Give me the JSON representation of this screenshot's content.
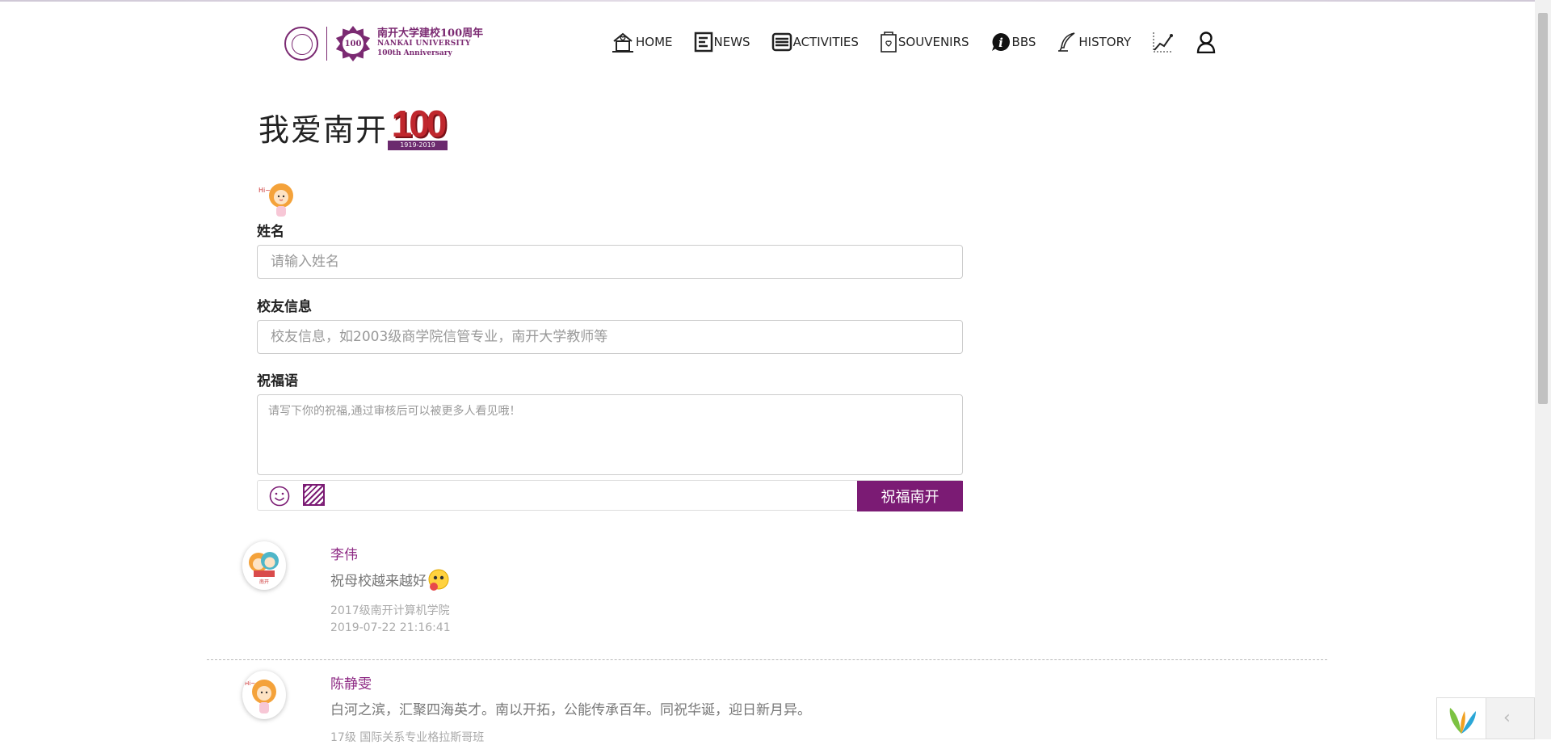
{
  "header": {
    "logo": {
      "line1": "南开大学建校100周年",
      "line2": "NANKAI UNIVERSITY",
      "line3": "100th Anniversary",
      "badge": "100"
    },
    "nav": [
      {
        "label": "HOME",
        "icon": "home-icon"
      },
      {
        "label": "NEWS",
        "icon": "news-icon"
      },
      {
        "label": "ACTIVITIES",
        "icon": "activities-icon"
      },
      {
        "label": "SOUVENIRS",
        "icon": "souvenirs-icon"
      },
      {
        "label": "BBS",
        "icon": "info-icon"
      },
      {
        "label": "HISTORY",
        "icon": "quill-icon"
      },
      {
        "label": "",
        "icon": "chart-icon"
      },
      {
        "label": "",
        "icon": "user-icon"
      }
    ]
  },
  "hero": {
    "title": "我爱南开",
    "badge_number": "100",
    "badge_years": "1919-2019"
  },
  "form": {
    "name_label": "姓名",
    "name_placeholder": "请输入姓名",
    "alumni_label": "校友信息",
    "alumni_placeholder": "校友信息，如2003级商学院信管专业，南开大学教师等",
    "wish_label": "祝福语",
    "wish_placeholder": "请写下你的祝福,通过审核后可以被更多人看见哦！",
    "submit_label": "祝福南开"
  },
  "comments": [
    {
      "name": "李伟",
      "text": "祝母校越来越好",
      "info": "2017级南开计算机学院",
      "time": "2019-07-22 21:16:41"
    },
    {
      "name": "陈静雯",
      "text": "白河之滨，汇聚四海英才。南以开拓，公能传承百年。同祝华诞，迎日新月异。",
      "info": "17级 国际关系专业格拉斯哥班",
      "time": ""
    }
  ],
  "colors": {
    "brand": "#7b1b74",
    "name": "#8e2a84"
  }
}
